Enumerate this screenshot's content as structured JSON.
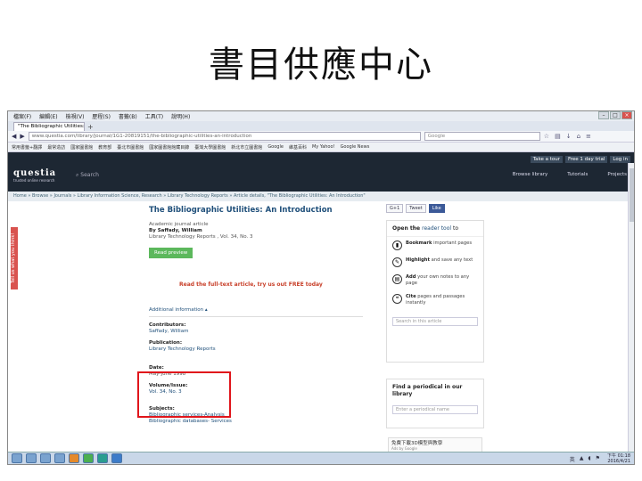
{
  "slide": {
    "title": "書目供應中心"
  },
  "browser": {
    "menu": [
      "檔案(F)",
      "編輯(E)",
      "檢視(V)",
      "歷程(S)",
      "書籤(B)",
      "工具(T)",
      "說明(H)"
    ],
    "tab_label": "\"The Bibliographic Utilities: An...",
    "tab_new": "+",
    "url": "www.questia.com/library/journal/1G1-20819151/the-bibliographic-utilities-an-introduction",
    "search_placeholder": "Google",
    "bookmarks": [
      "常用書籤+翻譯",
      "最常造訪",
      "國家圖書館",
      "教育部",
      "臺北市圖書館",
      "國家圖書館館藏目錄",
      "臺灣大學圖書館",
      "新北市立圖書館",
      "Google",
      "維基百科",
      "My Yahoo!",
      "Google News"
    ]
  },
  "site": {
    "logo": "questia",
    "logo_tagline": "trusted online research",
    "search_label": "Search",
    "top_buttons": [
      "Take a tour",
      "Free 1 day trial",
      "Log in"
    ],
    "nav": [
      "Browse library",
      "Tutorials",
      "Projects"
    ],
    "breadcrumb": "Home » Browse » Journals » Library Information Science, Research » Library Technology Reports » Article details, \"The Bibliographic Utilities: An Introduction\"",
    "feedback_tab": "Tell us what you think!"
  },
  "article": {
    "title": "The Bibliographic Utilities: An Introduction",
    "type": "Academic journal article",
    "byline": "By Saffady, William",
    "source": "Library Technology Reports , Vol. 34, No. 3",
    "read_button": "Read preview",
    "fulltext_link": "Read the full-text article, try us out FREE today",
    "additional_info": "Additional information ▴",
    "contributors_label": "Contributors:",
    "contributors_value": "Saffady, William",
    "publication_label": "Publication:",
    "publication_value": "Library Technology Reports",
    "date_label": "Date:",
    "date_value": "May-June 1998",
    "volume_label": "Volume/Issue:",
    "volume_value": "Vol. 34, No. 3",
    "subjects_label": "Subjects:",
    "subject_1": "Bibliographic services-Analysis",
    "subject_2": "Bibliographic databases- Services"
  },
  "sidebar": {
    "share_gplus": "G+1",
    "share_tweet": "Tweet",
    "share_like": "Like",
    "reader_heading_pre": "Open the ",
    "reader_heading_link": "reader tool",
    "reader_heading_post": " to",
    "features": [
      {
        "strong": "Bookmark",
        "text": " important pages"
      },
      {
        "strong": "Highlight",
        "text": " and save any text"
      },
      {
        "strong": "Add",
        "text": " your own notes to any page"
      },
      {
        "strong": "Cite",
        "text": " pages and passages instantly"
      }
    ],
    "search_article_placeholder": "Search in this article",
    "periodical_heading": "Find a periodical in our library",
    "periodical_placeholder": "Enter a periodical name",
    "ad_text": "免費下載3D模型與教學",
    "ad_sub": "Ads by Google"
  },
  "taskbar": {
    "time": "下午 01:18",
    "date": "2016/4/21",
    "lang": "英"
  }
}
